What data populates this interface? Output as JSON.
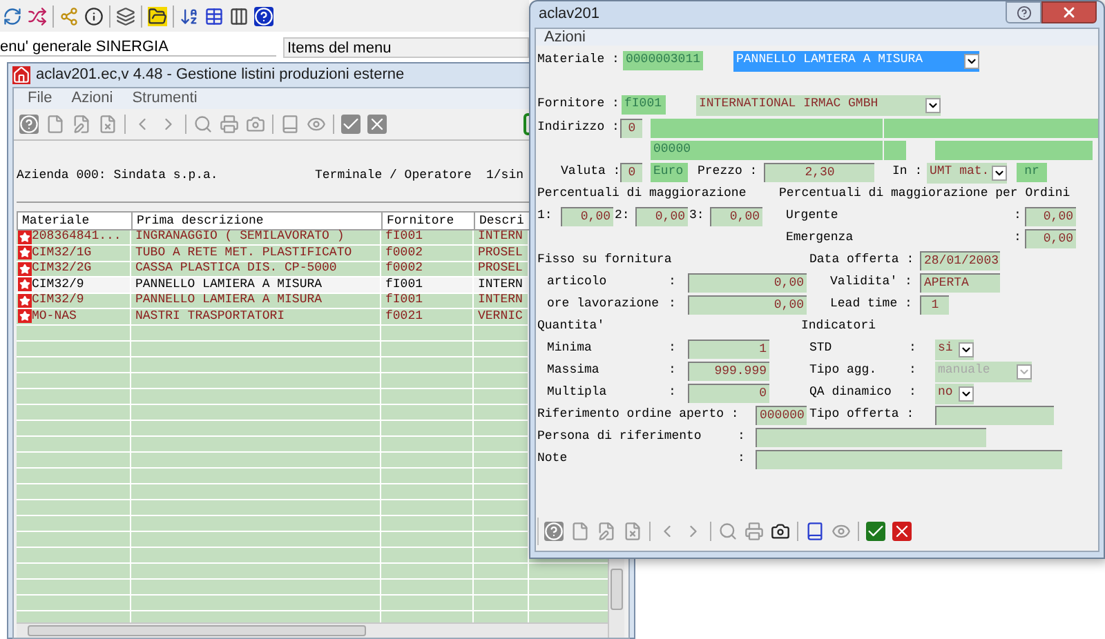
{
  "menu_panel": {
    "title": "enu' generale SINERGIA",
    "items_header": "Items del menu"
  },
  "list_window": {
    "title": "aclav201.ec,v 4.48 - Gestione listini produzioni esterne",
    "menu": [
      "File",
      "Azioni",
      "Strumenti"
    ],
    "company": "Azienda 000: Sindata s.p.a.",
    "terminal": "Terminale / Operatore",
    "operator": "1/sin",
    "table": {
      "columns": [
        "Materiale",
        "Prima descrizione",
        "Fornitore",
        "Descri"
      ],
      "rows": [
        {
          "cells": [
            "208364841...",
            "INGRANAGGIO ( SEMILAVORATO )",
            "fI001",
            "INTERN"
          ],
          "selected": false
        },
        {
          "cells": [
            "CIM32/1G",
            "TUBO A RETE MET. PLASTIFICATO",
            "f0002",
            "PROSEL"
          ],
          "selected": false
        },
        {
          "cells": [
            "CIM32/2G",
            "CASSA PLASTICA DIS. CP-5000",
            "f0002",
            "PROSEL"
          ],
          "selected": false
        },
        {
          "cells": [
            "CIM32/9",
            "PANNELLO LAMIERA A MISURA",
            "fI001",
            "INTERN"
          ],
          "selected": true
        },
        {
          "cells": [
            "CIM32/9",
            "PANNELLO LAMIERA A MISURA",
            "fI001",
            "INTERN"
          ],
          "selected": false
        },
        {
          "cells": [
            "MO-NAS",
            "NASTRI TRASPORTATORI",
            "f0021",
            "VERNIC"
          ],
          "selected": false
        }
      ]
    }
  },
  "dialog": {
    "title": "aclav201",
    "menu": [
      "Azioni"
    ],
    "materiale": {
      "label": "Materiale :",
      "code": "0000003011",
      "description": "PANNELLO LAMIERA A MISURA",
      "description_focused": true
    },
    "fornitore": {
      "label": "Fornitore :",
      "code": "fI001",
      "name": "INTERNATIONAL IRMAC GMBH"
    },
    "indirizzo": {
      "label": "Indirizzo :",
      "code": "0",
      "postal_code": "00000"
    },
    "valuta": {
      "label": "Valuta :",
      "code": "0",
      "currency": "Euro"
    },
    "prezzo": {
      "label": "Prezzo :",
      "value": "2,30"
    },
    "unita": {
      "label": "In :",
      "value": "UMT mat.",
      "unit": "nr"
    },
    "maggiorazione": {
      "title": "Percentuali di maggiorazione",
      "items": [
        {
          "label": "1:",
          "value": "0,00"
        },
        {
          "label": "2:",
          "value": "0,00"
        },
        {
          "label": "3:",
          "value": "0,00"
        }
      ]
    },
    "maggiorazione_ordini": {
      "title": "Percentuali di maggiorazione per Ordini",
      "items": [
        {
          "label": "Urgente",
          "sep": ":",
          "value": "0,00"
        },
        {
          "label": "Emergenza",
          "sep": ":",
          "value": "0,00"
        }
      ]
    },
    "fisso": {
      "title": "Fisso su fornitura",
      "items": [
        {
          "label": "articolo",
          "sep": ":",
          "value": "0,00"
        },
        {
          "label": "ore lavorazione",
          "sep": ":",
          "value": "0,00"
        }
      ]
    },
    "offerta": [
      {
        "label": "Data offerta :",
        "value": "28/01/2003"
      },
      {
        "label": "Validita' :",
        "value": "APERTA"
      },
      {
        "label": "Lead time :",
        "value": "1"
      }
    ],
    "quantita": {
      "title": "Quantita'",
      "items": [
        {
          "label": "Minima",
          "sep": ":",
          "value": "1"
        },
        {
          "label": "Massima",
          "sep": ":",
          "value": "999.999"
        },
        {
          "label": "Multipla",
          "sep": ":",
          "value": "0"
        }
      ]
    },
    "indicatori": {
      "title": "Indicatori",
      "items": [
        {
          "label": "STD",
          "sep": ":",
          "value": "si",
          "disabled": false
        },
        {
          "label": "Tipo agg.",
          "sep": ":",
          "value": "manuale",
          "disabled": true
        },
        {
          "label": "QA dinamico",
          "sep": ":",
          "value": "no",
          "disabled": false
        }
      ]
    },
    "riferimento_ordine": {
      "label": "Riferimento ordine aperto :",
      "value": "000000"
    },
    "tipo_offerta": {
      "label": "Tipo offerta :"
    },
    "persona": {
      "label": "Persona di riferimento",
      "sep": ":"
    },
    "note": {
      "label": "Note",
      "sep": ":"
    }
  }
}
